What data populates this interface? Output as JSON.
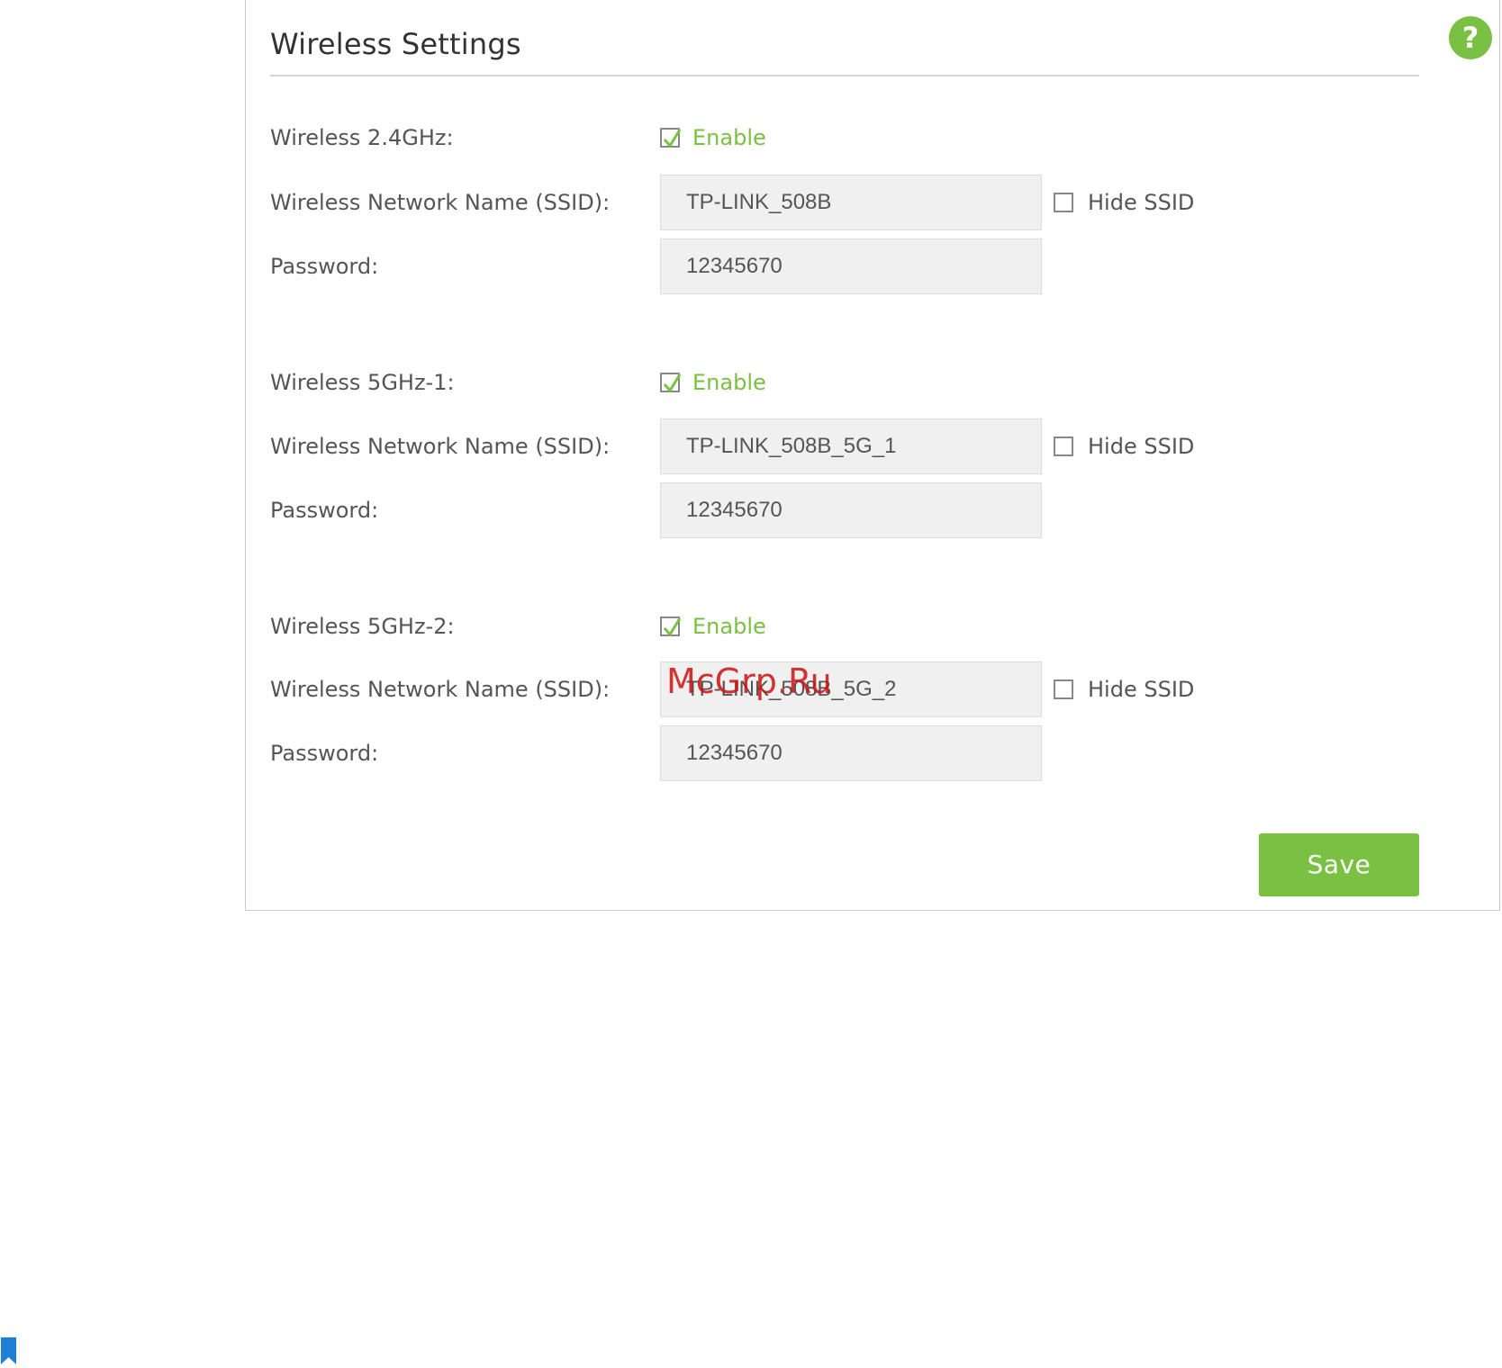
{
  "panel": {
    "title": "Wireless Settings",
    "help_icon": "question-mark-icon",
    "help_glyph": "?"
  },
  "bands": [
    {
      "band_label": "Wireless 2.4GHz:",
      "enable_label": "Enable",
      "enabled": true,
      "ssid_label": "Wireless Network Name (SSID):",
      "ssid_value": "TP-LINK_508B",
      "hide_ssid_label": "Hide SSID",
      "hide_ssid": false,
      "password_label": "Password:",
      "password_value": "12345670"
    },
    {
      "band_label": "Wireless 5GHz-1:",
      "enable_label": "Enable",
      "enabled": true,
      "ssid_label": "Wireless Network Name (SSID):",
      "ssid_value": "TP-LINK_508B_5G_1",
      "hide_ssid_label": "Hide SSID",
      "hide_ssid": false,
      "password_label": "Password:",
      "password_value": "12345670"
    },
    {
      "band_label": "Wireless 5GHz-2:",
      "enable_label": "Enable",
      "enabled": true,
      "ssid_label": "Wireless Network Name (SSID):",
      "ssid_value": "TP-LINK_508B_5G_2",
      "hide_ssid_label": "Hide SSID",
      "hide_ssid": false,
      "password_label": "Password:",
      "password_value": "12345670"
    }
  ],
  "save_label": "Save",
  "watermark_text": "McGrp.Ru",
  "colors": {
    "accent_green": "#7ac143",
    "watermark_red": "#cc1111",
    "bookmark_blue": "#1f7fd6"
  }
}
